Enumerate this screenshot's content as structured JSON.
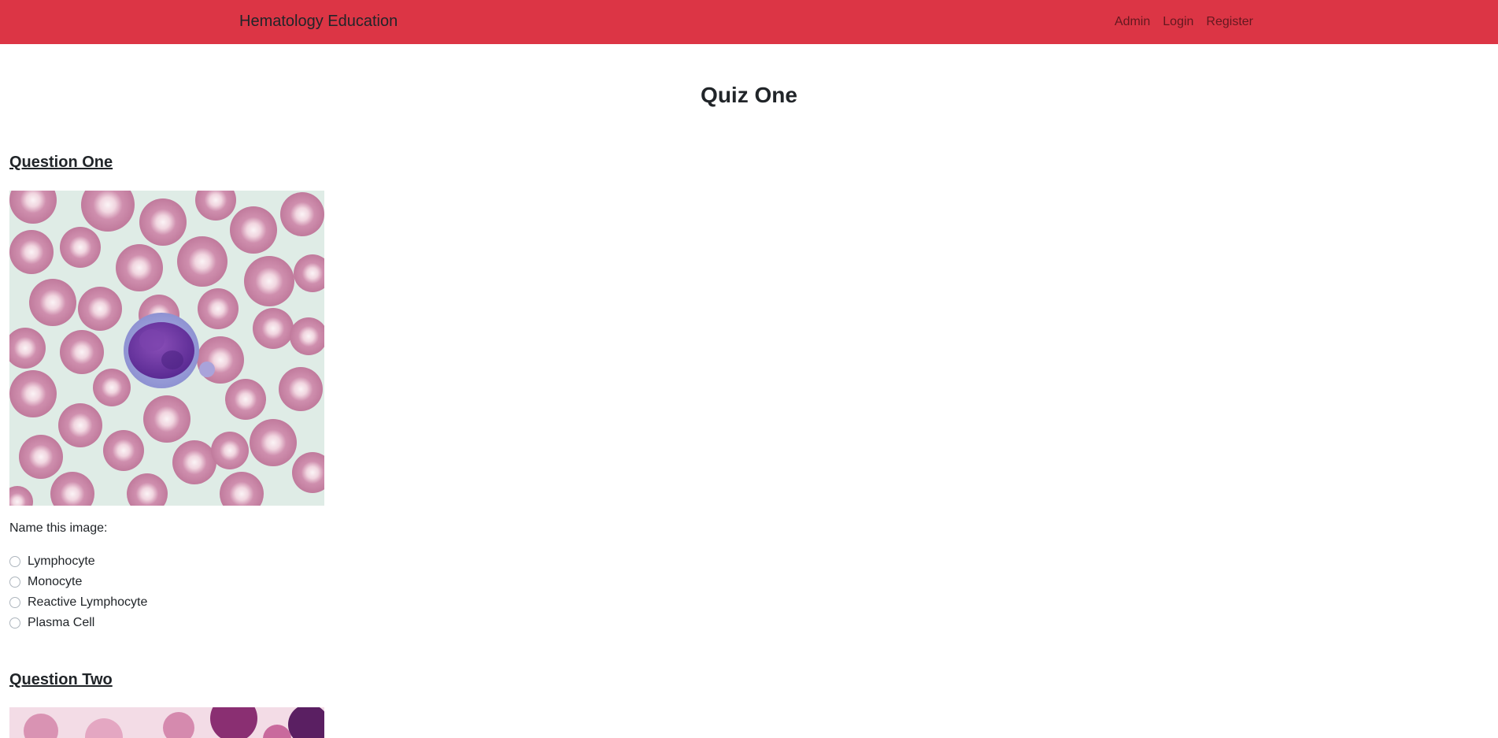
{
  "navbar": {
    "brand": "Hematology Education",
    "links": [
      "Admin",
      "Login",
      "Register"
    ],
    "background_color": "#dc3545"
  },
  "page_title": "Quiz One",
  "questions": [
    {
      "heading": "Question One",
      "prompt": "Name this image:",
      "options": [
        "Lymphocyte",
        "Monocyte",
        "Reactive Lymphocyte",
        "Plasma Cell"
      ]
    },
    {
      "heading": "Question Two"
    }
  ]
}
